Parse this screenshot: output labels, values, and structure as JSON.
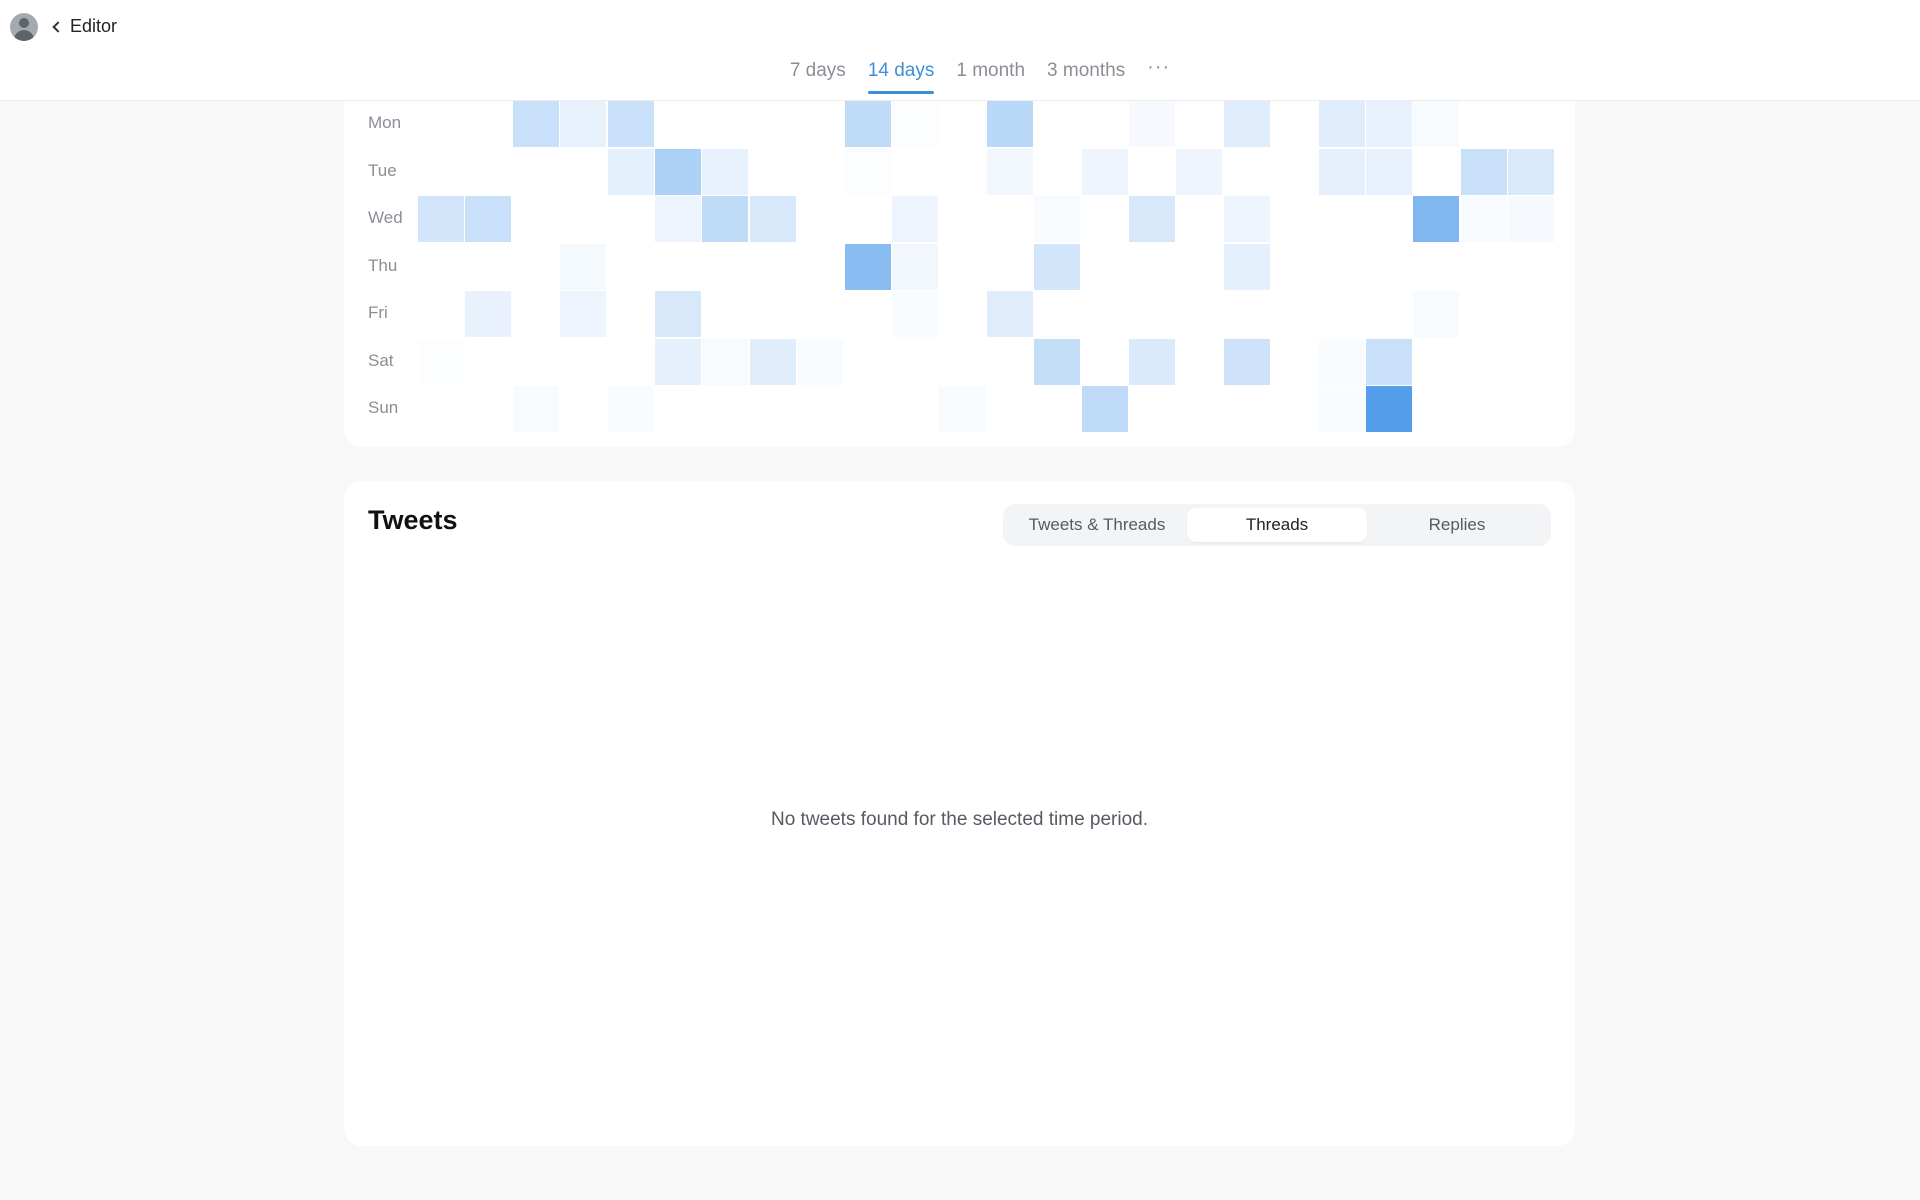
{
  "header": {
    "back_label": "Editor",
    "tabs": [
      {
        "label": "7 days",
        "active": false
      },
      {
        "label": "14 days",
        "active": true
      },
      {
        "label": "1 month",
        "active": false
      },
      {
        "label": "3 months",
        "active": false
      }
    ],
    "more_label": "···"
  },
  "heatmap": {
    "days": [
      "Mon",
      "Tue",
      "Wed",
      "Thu",
      "Fri",
      "Sat",
      "Sun"
    ],
    "columns": 24,
    "base_color": "#4a98ea",
    "intensity": [
      [
        0,
        0,
        0.3,
        0.13,
        0.3,
        0,
        0,
        0,
        0,
        0.35,
        0.02,
        0,
        0.38,
        0,
        0,
        0.05,
        0,
        0.18,
        0,
        0.18,
        0.13,
        0.04,
        0,
        0
      ],
      [
        0,
        0,
        0,
        0,
        0.15,
        0.45,
        0.13,
        0,
        0,
        0.02,
        0,
        0,
        0.08,
        0,
        0.1,
        0,
        0.1,
        0,
        0,
        0.14,
        0.12,
        0,
        0.3,
        0.2
      ],
      [
        0.25,
        0.3,
        0,
        0,
        0,
        0.1,
        0.35,
        0.22,
        0,
        0,
        0.1,
        0,
        0,
        0.04,
        0,
        0.22,
        0,
        0.1,
        0,
        0,
        0,
        0.7,
        0.04,
        0.05
      ],
      [
        0,
        0,
        0,
        0.06,
        0,
        0,
        0,
        0,
        0,
        0.65,
        0.08,
        0,
        0,
        0.25,
        0,
        0,
        0,
        0.15,
        0,
        0,
        0,
        0,
        0,
        0
      ],
      [
        0,
        0.12,
        0,
        0.1,
        0,
        0.22,
        0,
        0,
        0,
        0,
        0.03,
        0,
        0.18,
        0,
        0,
        0,
        0,
        0,
        0,
        0,
        0,
        0.04,
        0,
        0
      ],
      [
        0.02,
        0,
        0,
        0,
        0,
        0.14,
        0.04,
        0.17,
        0.03,
        0,
        0,
        0,
        0,
        0.32,
        0,
        0.2,
        0,
        0.28,
        0,
        0.03,
        0.3,
        0,
        0,
        0
      ],
      [
        0,
        0,
        0.04,
        0,
        0.03,
        0,
        0,
        0,
        0,
        0,
        0,
        0.04,
        0,
        0,
        0.35,
        0,
        0,
        0,
        0,
        0.03,
        0.95,
        0,
        0,
        0
      ]
    ]
  },
  "tweets": {
    "title": "Tweets",
    "filters": [
      {
        "label": "Tweets & Threads",
        "active": false
      },
      {
        "label": "Threads",
        "active": true
      },
      {
        "label": "Replies",
        "active": false
      }
    ],
    "empty_message": "No tweets found for the selected time period."
  }
}
